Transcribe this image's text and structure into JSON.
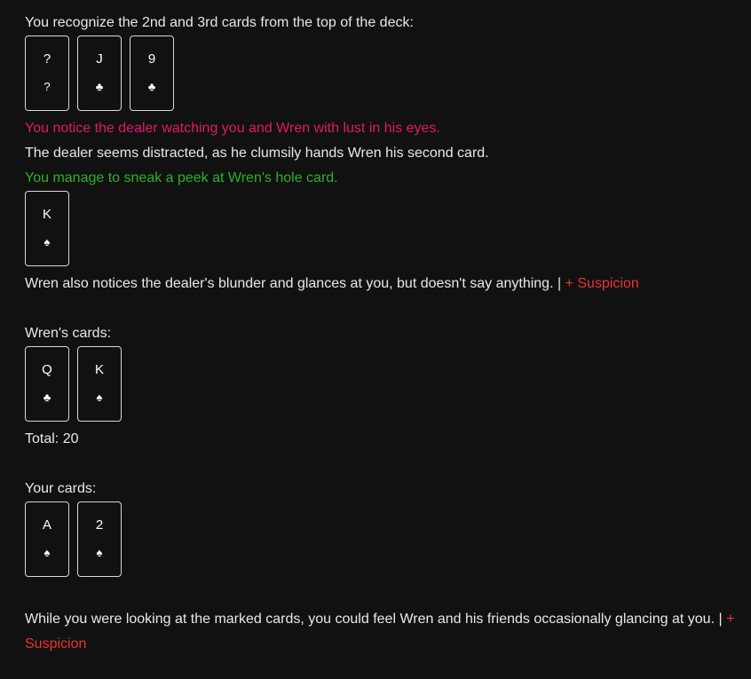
{
  "messages": {
    "recognize": "You recognize the 2nd and 3rd cards from the top of the deck:",
    "dealer_lust": "You notice the dealer watching you and Wren with lust in his eyes.",
    "dealer_distracted": "The dealer seems distracted, as he clumsily hands Wren his second card.",
    "sneak_peek": "You manage to sneak a peek at Wren's hole card.",
    "wren_notices": "Wren also notices the dealer's blunder and glances at you, but doesn't say anything. | ",
    "wren_notices_tag": "+ Suspicion",
    "wren_cards_label": "Wren's cards:",
    "wren_total": "Total: 20",
    "your_cards_label": "Your cards:",
    "marked_cards": "While you were looking at the marked cards, you could feel Wren and his friends occasionally glancing at you. | ",
    "marked_cards_tag": "+ Suspicion"
  },
  "deck_cards": [
    {
      "rank": "?",
      "suit": "?"
    },
    {
      "rank": "J",
      "suit": "♣"
    },
    {
      "rank": "9",
      "suit": "♣"
    }
  ],
  "hole_card": [
    {
      "rank": "K",
      "suit": "♠"
    }
  ],
  "wren_cards": [
    {
      "rank": "Q",
      "suit": "♣"
    },
    {
      "rank": "K",
      "suit": "♠"
    }
  ],
  "your_cards": [
    {
      "rank": "A",
      "suit": "♠"
    },
    {
      "rank": "2",
      "suit": "♠"
    }
  ],
  "colors": {
    "background": "#111111",
    "text": "#e8e8e8",
    "pink": "#e0186c",
    "green": "#2bb12b",
    "red": "#ee3333"
  }
}
